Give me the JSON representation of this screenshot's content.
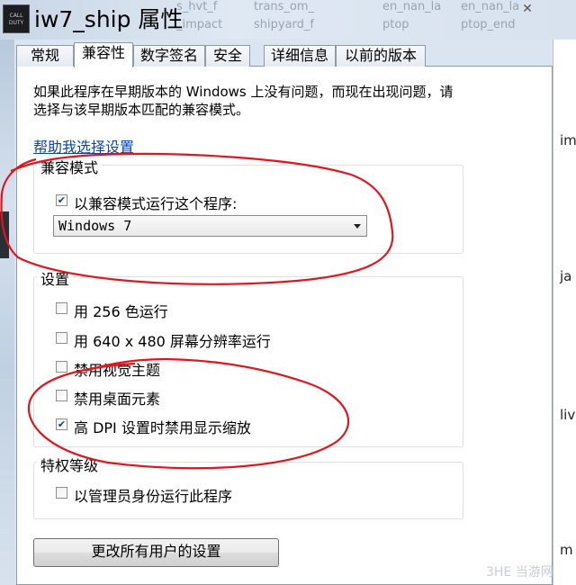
{
  "window": {
    "title": "iw7_ship 属性",
    "close_glyph": "✕",
    "app_icon_text": "CALL DUTY"
  },
  "background": {
    "fragments": [
      "s_hvt_f",
      "trans_om_",
      "en_nan_la",
      "en_nan_la",
      "_impact",
      "shipyard_f",
      "ptop",
      "ptop_end"
    ],
    "side_labels": [
      "im",
      "ja",
      "liv",
      "m"
    ]
  },
  "tabs": [
    {
      "label": "常规",
      "active": false
    },
    {
      "label": "兼容性",
      "active": true
    },
    {
      "label": "数字签名",
      "active": false
    },
    {
      "label": "安全",
      "active": false
    },
    {
      "label": "详细信息",
      "active": false
    },
    {
      "label": "以前的版本",
      "active": false
    }
  ],
  "description": "如果此程序在早期版本的 Windows 上没有问题，而现在出现问题，请选择与该早期版本匹配的兼容模式。",
  "help_link": "帮助我选择设置",
  "compat_mode": {
    "title": "兼容模式",
    "checkbox": {
      "label": "以兼容模式运行这个程序:",
      "checked": true
    },
    "select_value": "Windows 7"
  },
  "settings": {
    "title": "设置",
    "items": [
      {
        "label": "用 256 色运行",
        "checked": false
      },
      {
        "label": "用 640 x 480 屏幕分辨率运行",
        "checked": false
      },
      {
        "label": "禁用视觉主题",
        "checked": false
      },
      {
        "label": "禁用桌面元素",
        "checked": false
      },
      {
        "label": "高 DPI 设置时禁用显示缩放",
        "checked": true
      }
    ]
  },
  "privilege": {
    "title": "特权等级",
    "checkbox": {
      "label": "以管理员身份运行此程序",
      "checked": false
    }
  },
  "change_all_button": "更改所有用户的设置",
  "watermark": "3HE 当游网",
  "colors": {
    "annotation": "#e0161f",
    "link": "#0a47a6"
  }
}
